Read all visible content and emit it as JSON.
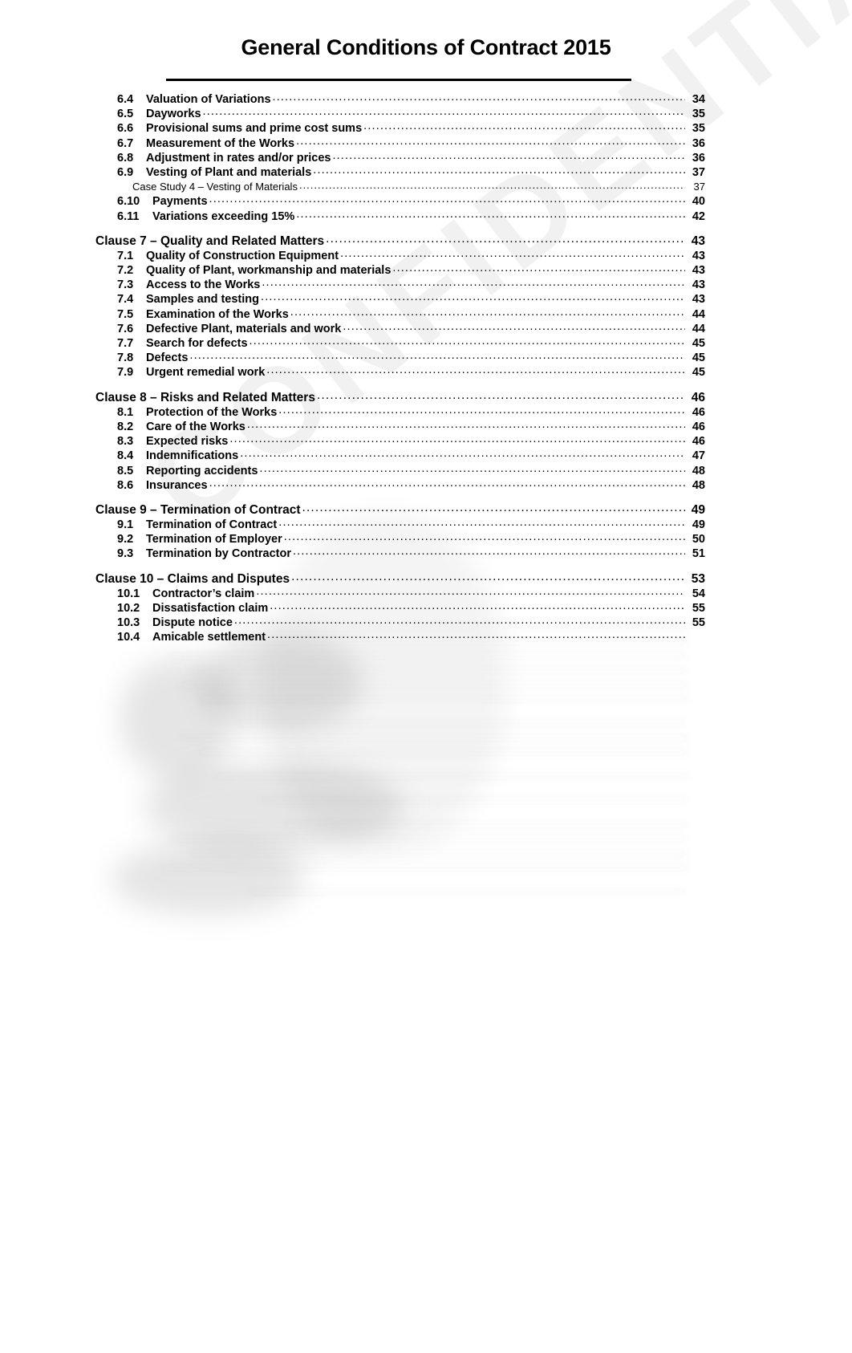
{
  "document": {
    "title": "General Conditions of Contract 2015",
    "watermark_text": "CONFIDENTIAL"
  },
  "toc": {
    "entries": [
      {
        "level": "sub",
        "number": "6.4",
        "label": "Valuation of Variations",
        "page": "34"
      },
      {
        "level": "sub",
        "number": "6.5",
        "label": "Dayworks",
        "page": "35"
      },
      {
        "level": "sub",
        "number": "6.6",
        "label": "Provisional sums and prime cost sums",
        "page": "35"
      },
      {
        "level": "sub",
        "number": "6.7",
        "label": "Measurement of the Works",
        "page": "36"
      },
      {
        "level": "sub",
        "number": "6.8",
        "label": "Adjustment in rates and/or prices",
        "page": "36"
      },
      {
        "level": "sub",
        "number": "6.9",
        "label": "Vesting of Plant and materials",
        "page": "37"
      },
      {
        "level": "case",
        "number": "",
        "label": "Case Study 4 – Vesting of Materials",
        "page": "37"
      },
      {
        "level": "sub",
        "number": "6.10",
        "label": "Payments",
        "page": "40",
        "wide": true
      },
      {
        "level": "sub",
        "number": "6.11",
        "label": "Variations exceeding 15%",
        "page": "42",
        "wide": true
      },
      {
        "level": "gap"
      },
      {
        "level": "clause",
        "number": "",
        "label": "Clause 7 – Quality and Related Matters",
        "page": "43"
      },
      {
        "level": "sub",
        "number": "7.1",
        "label": "Quality of Construction Equipment",
        "page": "43"
      },
      {
        "level": "sub",
        "number": "7.2",
        "label": "Quality of Plant, workmanship and materials",
        "page": "43"
      },
      {
        "level": "sub",
        "number": "7.3",
        "label": "Access to the Works",
        "page": "43"
      },
      {
        "level": "sub",
        "number": "7.4",
        "label": "Samples and testing",
        "page": "43"
      },
      {
        "level": "sub",
        "number": "7.5",
        "label": "Examination of the Works",
        "page": "44"
      },
      {
        "level": "sub",
        "number": "7.6",
        "label": "Defective Plant, materials and work",
        "page": "44"
      },
      {
        "level": "sub",
        "number": "7.7",
        "label": "Search for defects",
        "page": "45"
      },
      {
        "level": "sub",
        "number": "7.8",
        "label": "Defects",
        "page": "45"
      },
      {
        "level": "sub",
        "number": "7.9",
        "label": "Urgent remedial work",
        "page": "45"
      },
      {
        "level": "gap"
      },
      {
        "level": "clause",
        "number": "",
        "label": "Clause 8 – Risks and Related Matters",
        "page": "46"
      },
      {
        "level": "sub",
        "number": "8.1",
        "label": "Protection of the Works",
        "page": "46"
      },
      {
        "level": "sub",
        "number": "8.2",
        "label": "Care of the Works",
        "page": "46"
      },
      {
        "level": "sub",
        "number": "8.3",
        "label": "Expected risks",
        "page": "46"
      },
      {
        "level": "sub",
        "number": "8.4",
        "label": "Indemnifications",
        "page": "47"
      },
      {
        "level": "sub",
        "number": "8.5",
        "label": "Reporting accidents",
        "page": "48"
      },
      {
        "level": "sub",
        "number": "8.6",
        "label": "Insurances",
        "page": "48"
      },
      {
        "level": "gap"
      },
      {
        "level": "clause",
        "number": "",
        "label": "Clause 9 – Termination of Contract",
        "page": "49"
      },
      {
        "level": "sub",
        "number": "9.1",
        "label": "Termination of Contract",
        "page": "49"
      },
      {
        "level": "sub",
        "number": "9.2",
        "label": "Termination of Employer",
        "page": "50"
      },
      {
        "level": "sub",
        "number": "9.3",
        "label": "Termination by Contractor",
        "page": "51"
      },
      {
        "level": "gap"
      },
      {
        "level": "clause",
        "number": "",
        "label": "Clause 10 – Claims and Disputes",
        "page": "53"
      },
      {
        "level": "sub",
        "number": "10.1",
        "label": "Contractor’s claim",
        "page": "54",
        "wide": true
      },
      {
        "level": "sub",
        "number": "10.2",
        "label": "Dissatisfaction claim",
        "page": "55",
        "wide": true
      },
      {
        "level": "sub",
        "number": "10.3",
        "label": "Dispute notice",
        "page": "55",
        "wide": true
      },
      {
        "level": "sub",
        "number": "10.4",
        "label": "Amicable settlement",
        "page": "",
        "wide": true
      }
    ]
  },
  "redacted_section": {
    "note": "lower portion of the contents list is visually blurred and illegible",
    "rows": [
      {
        "style": "sub",
        "label": "      ",
        "page": ""
      },
      {
        "style": "sub",
        "label": "           ",
        "page": ""
      },
      {
        "style": "sub",
        "label": "     ",
        "page": ""
      },
      {
        "style": "sub",
        "label": "       ",
        "page": ""
      },
      {
        "style": "sub",
        "label": "      ",
        "page": ""
      },
      {
        "style": "sub",
        "label": "        ",
        "page": ""
      },
      {
        "style": "gap",
        "label": "",
        "page": ""
      },
      {
        "style": "head",
        "label": "            ",
        "page": ""
      },
      {
        "style": "sub",
        "label": "      ",
        "page": ""
      },
      {
        "style": "sub",
        "label": "        ",
        "page": ""
      },
      {
        "style": "gap",
        "label": "",
        "page": ""
      },
      {
        "style": "head",
        "label": "          ",
        "page": ""
      },
      {
        "style": "gap",
        "label": "",
        "page": ""
      },
      {
        "style": "head",
        "label": "              ",
        "page": ""
      },
      {
        "style": "gap",
        "label": "",
        "page": ""
      },
      {
        "style": "head",
        "label": "                ",
        "page": ""
      },
      {
        "style": "sub",
        "label": "     ",
        "page": ""
      },
      {
        "style": "sub",
        "label": "       ",
        "page": ""
      },
      {
        "style": "sub",
        "label": "    ",
        "page": ""
      },
      {
        "style": "gap",
        "label": "",
        "page": ""
      },
      {
        "style": "head",
        "label": "             ",
        "page": ""
      }
    ]
  }
}
